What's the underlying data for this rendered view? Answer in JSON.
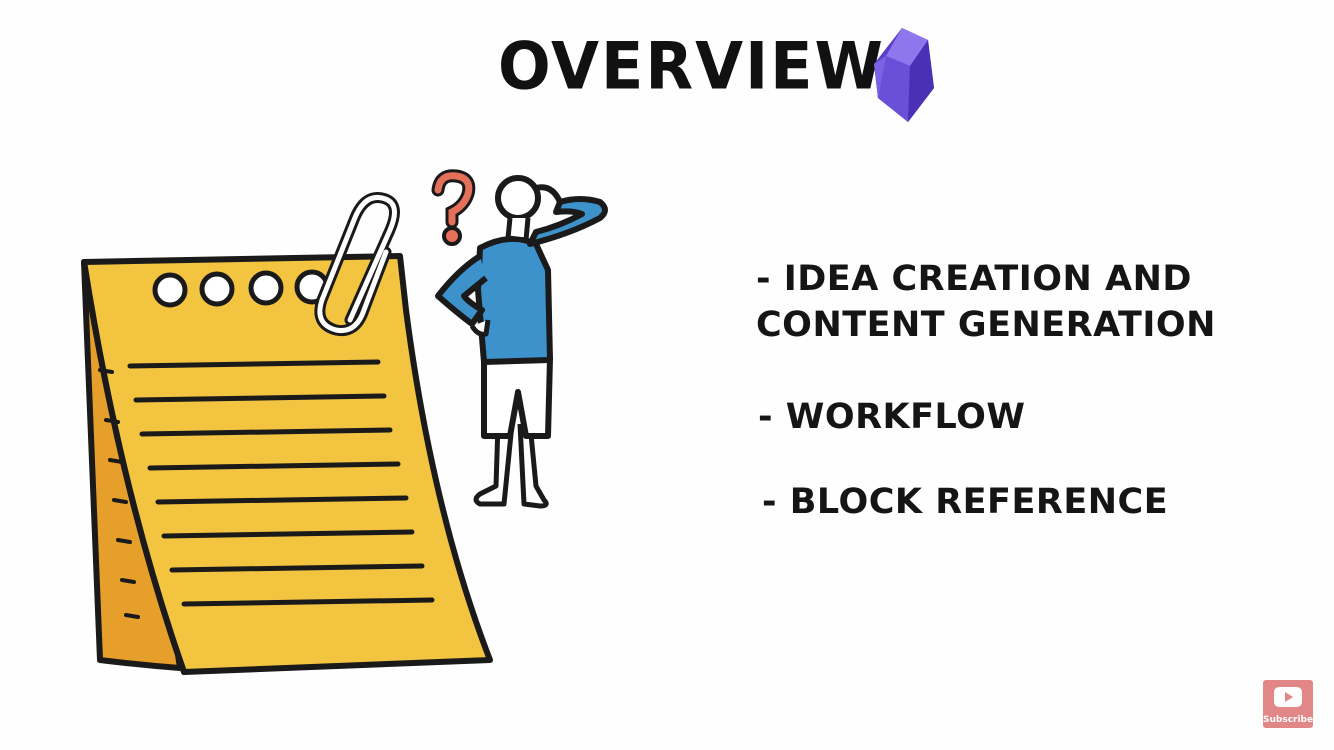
{
  "slide": {
    "title": "OVERVIEW",
    "bullets": [
      "- IDEA CREATION AND\nCONTENT GENERATION",
      "- WORKFLOW",
      "- BLOCK REFERENCE"
    ]
  },
  "logo": {
    "icon": "gem-crystal-icon",
    "color": "#6b4fd8"
  },
  "illustration": {
    "notepad_color": "#f2c440",
    "shirt_color": "#3d92cc",
    "question_mark_color": "#e4705a"
  },
  "subscribe": {
    "label": "Subscribe",
    "icon": "youtube-play-icon"
  }
}
